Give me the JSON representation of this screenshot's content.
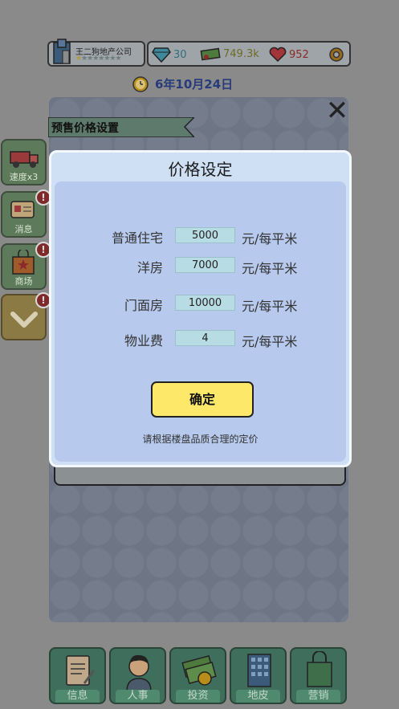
{
  "header": {
    "company_name": "王二狗地产公司",
    "stars_total": 8,
    "stars_lit": 1,
    "gems": "30",
    "cash": "749.3k",
    "hearts": "952",
    "date": "6年10月24日"
  },
  "panel": {
    "title": "预售价格设置"
  },
  "sidebar": {
    "items": [
      {
        "label": "速度x3",
        "badge": ""
      },
      {
        "label": "消息",
        "badge": "!"
      },
      {
        "label": "商场",
        "badge": "!"
      },
      {
        "label": "",
        "badge": "!"
      }
    ]
  },
  "modal": {
    "title": "价格设定",
    "rows": [
      {
        "label": "普通住宅",
        "value": "5000",
        "unit": "元/每平米"
      },
      {
        "label": "洋房",
        "value": "7000",
        "unit": "元/每平米"
      },
      {
        "label": "门面房",
        "value": "10000",
        "unit": "元/每平米"
      },
      {
        "label": "物业费",
        "value": "4",
        "unit": "元/每平米"
      }
    ],
    "confirm_label": "确定",
    "hint": "请根据楼盘品质合理的定价"
  },
  "bottom_nav": {
    "items": [
      {
        "label": "信息"
      },
      {
        "label": "人事"
      },
      {
        "label": "投资"
      },
      {
        "label": "地皮"
      },
      {
        "label": "营销"
      }
    ]
  }
}
